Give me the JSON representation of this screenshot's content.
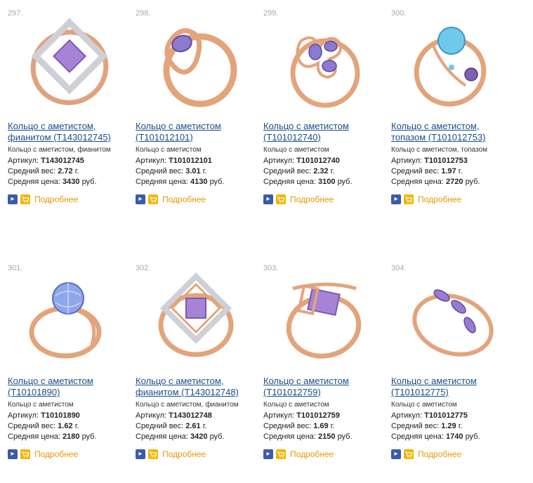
{
  "labels": {
    "article": "Артикул:",
    "weight": "Средний вес:",
    "price": "Средняя цена:",
    "more": "Подробнее"
  },
  "colors": {
    "link": "#1a4d8c",
    "more": "#e59a00",
    "gold": "#e2a37a",
    "amethyst": "#9b7bd1",
    "topaz": "#6ec9ea"
  },
  "products": [
    {
      "num": "297.",
      "title": "Кольцо с аметистом, фианитом (Т143012745)",
      "desc": "Кольцо с аметистом, фианитом",
      "article": "Т143012745",
      "weight": "2.72",
      "weight_unit": "г.",
      "price": "3430",
      "price_unit": "руб."
    },
    {
      "num": "298.",
      "title": "Кольцо с аметистом (Т101012101)",
      "desc": "Кольцо с аметистом",
      "article": "Т101012101",
      "weight": "3.01",
      "weight_unit": "г.",
      "price": "4130",
      "price_unit": "руб."
    },
    {
      "num": "299.",
      "title": "Кольцо с аметистом (Т101012740)",
      "desc": "Кольцо с аметистом",
      "article": "Т101012740",
      "weight": "2.32",
      "weight_unit": "г.",
      "price": "3100",
      "price_unit": "руб."
    },
    {
      "num": "300.",
      "title": "Кольцо с аметистом, топазом (Т101012753)",
      "desc": "Кольцо с аметистом, топазом",
      "article": "Т101012753",
      "weight": "1.97",
      "weight_unit": "г.",
      "price": "2720",
      "price_unit": "руб."
    },
    {
      "num": "301.",
      "title": "Кольцо с аметистом (Т10101890)",
      "desc": "Кольцо с аметистом",
      "article": "Т10101890",
      "weight": "1.62",
      "weight_unit": "г.",
      "price": "2180",
      "price_unit": "руб."
    },
    {
      "num": "302.",
      "title": "Кольцо с аметистом, фианитом (Т143012748)",
      "desc": "Кольцо с аметистом, фианитом",
      "article": "Т143012748",
      "weight": "2.61",
      "weight_unit": "г.",
      "price": "3420",
      "price_unit": "руб."
    },
    {
      "num": "303.",
      "title": "Кольцо с аметистом (Т101012759)",
      "desc": "Кольцо с аметистом",
      "article": "Т101012759",
      "weight": "1.69",
      "weight_unit": "г.",
      "price": "2150",
      "price_unit": "руб."
    },
    {
      "num": "304.",
      "title": "Кольцо с аметистом (Т101012775)",
      "desc": "Кольцо с аметистом",
      "article": "Т101012775",
      "weight": "1.29",
      "weight_unit": "г.",
      "price": "1740",
      "price_unit": "руб."
    }
  ]
}
